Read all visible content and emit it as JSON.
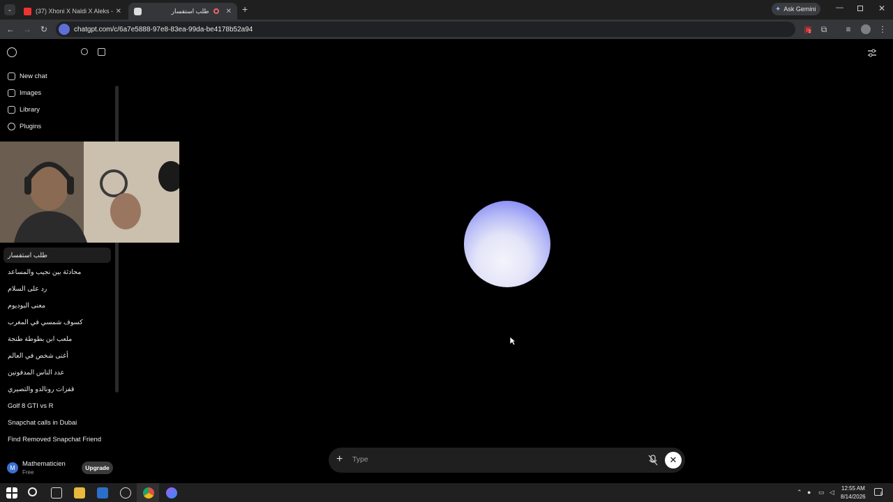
{
  "browser": {
    "tabs": [
      {
        "title": "(37) Xhoni X Naldi X Aleks - Ps..."
      },
      {
        "title": "طلب استفسار"
      }
    ],
    "new_tab": "+",
    "ask_gemini": "Ask Gemini",
    "url": "chatgpt.com/c/6a7e5888-97e8-83ea-99da-be4178b52a94",
    "extension_badge": "2"
  },
  "sidebar": {
    "nav": [
      {
        "label": "New chat",
        "icon": "edit-icon"
      },
      {
        "label": "Images",
        "icon": "images-icon"
      },
      {
        "label": "Library",
        "icon": "library-icon"
      },
      {
        "label": "Plugins",
        "icon": "plugins-icon"
      }
    ],
    "history": [
      "طلب استفسار",
      "محادثة بين نجيب والمساعد",
      "رد على السلام",
      "معنى البوديوم",
      "كسوف شمسي في المغرب",
      "ملعب ابن بطوطة طنجة",
      "أغنى شخص في العالم",
      "عدد الناس المدفونين",
      "قفزات رونالدو والتصيري",
      "Golf 8 GTI vs R",
      "Snapchat calls in Dubai",
      "Find Removed Snapchat Friend"
    ],
    "user": {
      "initial": "M",
      "name": "Mathematicien",
      "plan": "Free",
      "upgrade": "Upgrade"
    }
  },
  "composer": {
    "placeholder": "Type"
  },
  "taskbar": {
    "time": "12:55 AM",
    "date": "8/14/2026",
    "notifications": "8"
  }
}
